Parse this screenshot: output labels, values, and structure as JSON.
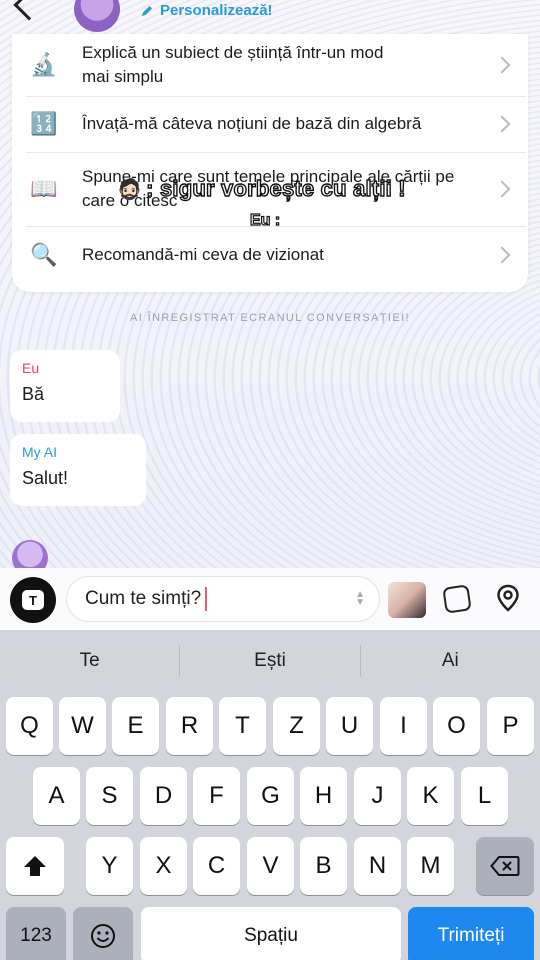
{
  "header": {
    "personalize_label": "Personalizează!"
  },
  "suggestions": [
    {
      "icon": "🔬",
      "line1": "Explică un subiect de știință într-un mod",
      "line2": "mai simplu"
    },
    {
      "icon": "🔢",
      "line1": "Învață-mă câteva noțiuni de bază din algebră",
      "line2": ""
    },
    {
      "icon": "📖",
      "line1": "Spune-mi care sunt temele principale ale cărții pe",
      "line2": "care o citesc"
    },
    {
      "icon": "🔍",
      "line1": "Recomandă-mi ceva de vizionat",
      "line2": ""
    }
  ],
  "overlay": {
    "caption": ": sigur vorbește cu alții !",
    "face": "🧔🏻",
    "eu_label": "Eu :"
  },
  "notice": "AI ÎNREGISTRAT ECRANUL CONVERSAȚIEI!",
  "messages": [
    {
      "sender": "Eu",
      "text": "Bă"
    },
    {
      "sender": "My AI",
      "text": "Salut!"
    }
  ],
  "input": {
    "value": "Cum te simți?"
  },
  "keyboard": {
    "predictions": [
      "Te",
      "Ești",
      "Ai"
    ],
    "row1": [
      "Q",
      "W",
      "E",
      "R",
      "T",
      "Z",
      "U",
      "I",
      "O",
      "P"
    ],
    "row2": [
      "A",
      "S",
      "D",
      "F",
      "G",
      "H",
      "J",
      "K",
      "L"
    ],
    "row3": [
      "Y",
      "X",
      "C",
      "V",
      "B",
      "N",
      "M"
    ],
    "numbers_label": "123",
    "space_label": "Spațiu",
    "send_label": "Trimiteți"
  },
  "colors": {
    "accent_blue": "#1e88f0",
    "eu_red": "#e8445e",
    "ai_blue": "#2a9bd6"
  }
}
